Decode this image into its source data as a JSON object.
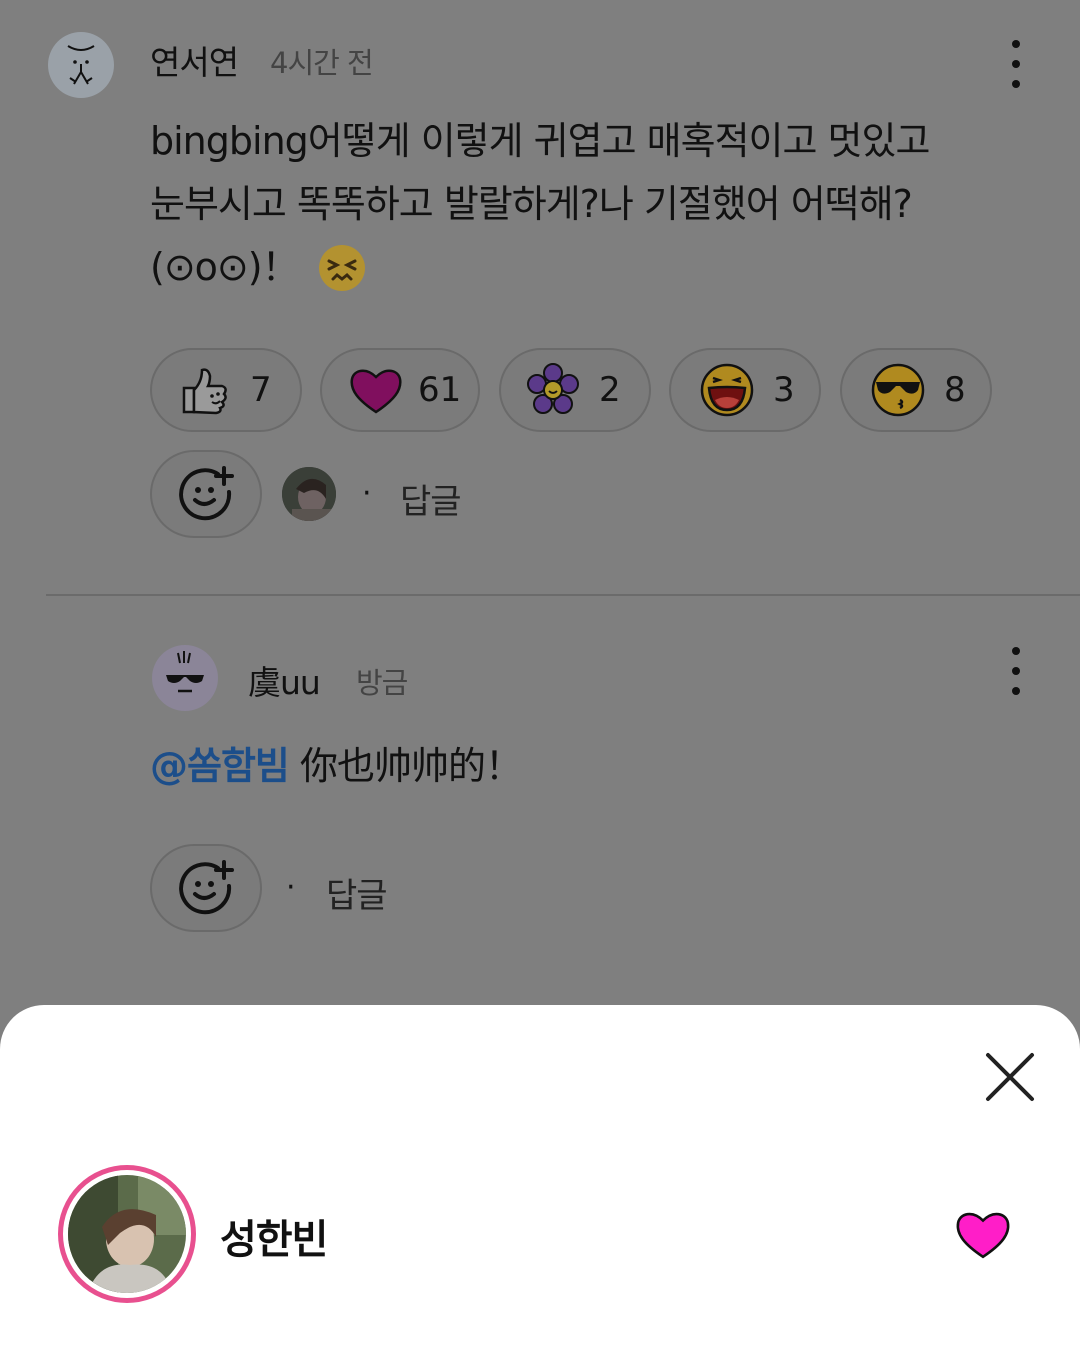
{
  "comment1": {
    "author": "연서연",
    "time": "4시간 전",
    "text_line1": "bingbing어떻게 이렇게 귀엽고 매혹적이고 멋있고",
    "text_line2": "눈부시고 똑똑하고 발랄하게?나 기절했어 어떡해?",
    "text_line3": "(⊙o⊙)！",
    "reactions": [
      {
        "icon": "thumbs-up-icon",
        "count": "7"
      },
      {
        "icon": "heart-icon",
        "count": "61"
      },
      {
        "icon": "flower-icon",
        "count": "2"
      },
      {
        "icon": "laughing-face-icon",
        "count": "3"
      },
      {
        "icon": "sunglasses-face-icon",
        "count": "8"
      }
    ],
    "separator": "·",
    "reply_label": "답글"
  },
  "comment2": {
    "author": "虞uu",
    "time": "방금",
    "mention": "@쏨함빔",
    "text": " 你也帅帅的！",
    "separator": "·",
    "reply_label": "답글"
  },
  "sheet": {
    "user_name": "성한빈",
    "reaction_icon": "heart-icon",
    "accent": "#e8508f",
    "heart_color": "#ff1ec8"
  }
}
